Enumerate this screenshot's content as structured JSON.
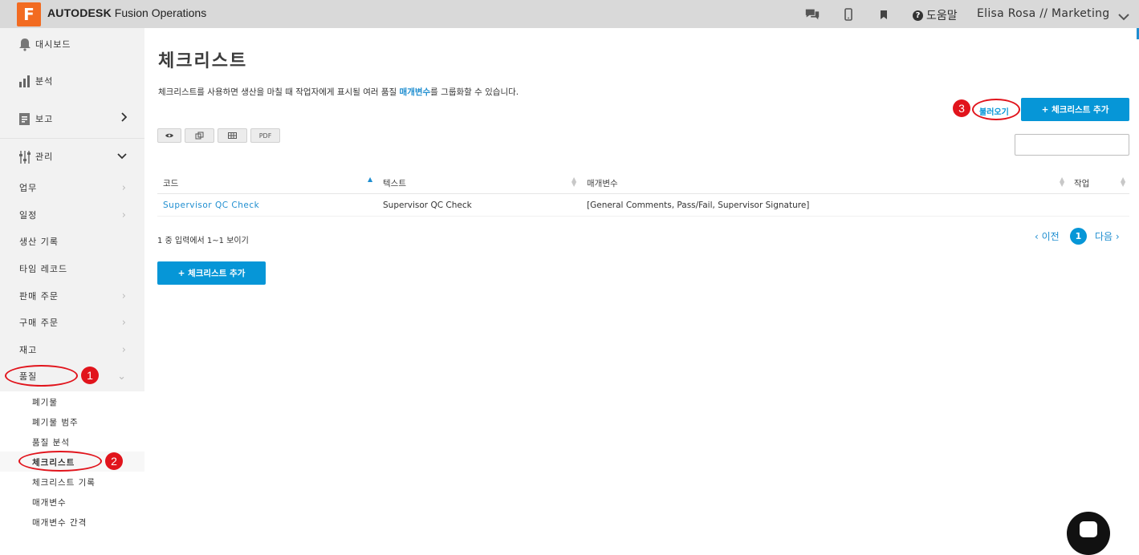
{
  "header": {
    "logo_letter": "F",
    "brand": "AUTODESK",
    "product": "Fusion Operations",
    "help_label": "도움말",
    "user": "Elisa Rosa // Marketing",
    "icons": [
      "chat-icon",
      "mobile-icon",
      "bookmark-icon",
      "help-icon",
      "chevron-down-icon"
    ]
  },
  "sidebar": {
    "main": [
      {
        "label": "대시보드",
        "icon": "bell-icon"
      },
      {
        "label": "분석",
        "icon": "bar-chart-icon"
      },
      {
        "label": "보고",
        "icon": "report-icon"
      },
      {
        "label": "관리",
        "icon": "sliders-icon"
      }
    ],
    "items": [
      "업무",
      "일정",
      "생산 기록",
      "타임 레코드",
      "판매 주문",
      "구매 주문",
      "재고",
      "품질"
    ],
    "quality_sub": [
      "폐기물",
      "폐기물 범주",
      "품질 분석",
      "체크리스트",
      "체크리스트 기록",
      "매개변수",
      "매개변수 간격"
    ]
  },
  "annotations": [
    "1",
    "2",
    "3"
  ],
  "main": {
    "title": "체크리스트",
    "desc_before": "체크리스트를 사용하면 생산을 마칠 때 작업자에게 표시될 여러 품질 ",
    "desc_link": "매개변수",
    "desc_after": "를 그룹화할 수 있습니다.",
    "import_label": "불러오기",
    "add_label": "+ 체크리스트 추가",
    "pdf_label": "PDF",
    "search_value": "",
    "columns": [
      "코드",
      "텍스트",
      "매개변수",
      "작업"
    ],
    "rows": [
      {
        "code": "Supervisor QC Check",
        "text": "Supervisor QC Check",
        "params": "[General Comments, Pass/Fail, Supervisor Signature]"
      }
    ],
    "info": "1 중 입력에서 1~1 보이기",
    "prev": "‹ 이전",
    "page": "1",
    "next": "다음 ›"
  },
  "colors": {
    "accent": "#0696d7",
    "brand_orange": "#f26b21",
    "annotation_red": "#e1141c"
  }
}
